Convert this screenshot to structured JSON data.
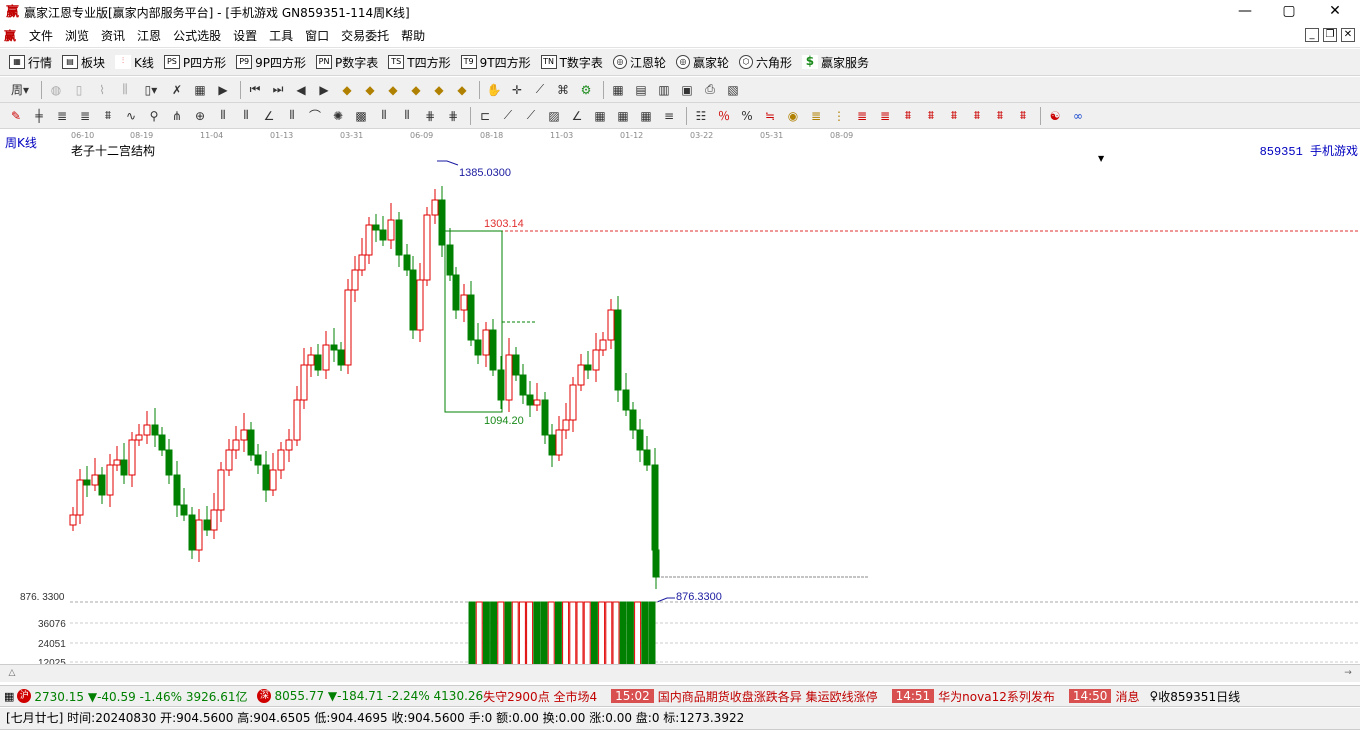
{
  "window": {
    "title": "赢家江恩专业版[赢家内部服务平台] - [手机游戏  GN859351-114周K线]",
    "logo_char": "赢",
    "min": "—",
    "max": "▢",
    "close": "✕"
  },
  "menu": [
    "文件",
    "浏览",
    "资讯",
    "江恩",
    "公式选股",
    "设置",
    "工具",
    "窗口",
    "交易委托",
    "帮助"
  ],
  "toolbar1": [
    {
      "icon": "grid-icon",
      "label": "行情"
    },
    {
      "icon": "block-icon",
      "label": "板块"
    },
    {
      "icon": "kline-icon",
      "label": "K线"
    },
    {
      "icon": "PS",
      "label": "P四方形"
    },
    {
      "icon": "P9",
      "label": "9P四方形"
    },
    {
      "icon": "PN",
      "label": "P数字表"
    },
    {
      "icon": "TS",
      "label": "T四方形"
    },
    {
      "icon": "T9",
      "label": "9T四方形"
    },
    {
      "icon": "TN",
      "label": "T数字表"
    },
    {
      "icon": "wheel-icon",
      "label": "江恩轮"
    },
    {
      "icon": "wheel-icon",
      "label": "赢家轮"
    },
    {
      "icon": "hexagon-icon",
      "label": "六角形"
    },
    {
      "icon": "dollar-icon",
      "label": "赢家服务"
    }
  ],
  "chart": {
    "period_label": "周K线",
    "indicator_name": "老子十二宫结构",
    "code_label": "859351  手机游戏",
    "time_axis": [
      "06-10",
      "08-19",
      "11-04",
      "01-13",
      "03-31",
      "06-09",
      "08-18",
      "11-03",
      "01-12",
      "03-22",
      "05-31",
      "08-09"
    ],
    "high_label": "1385.0300",
    "resistance_label": "1303.14",
    "box_low_label": "1094.20",
    "low_label": "876.3300",
    "left_price_label": "876. 3300",
    "volume_labels": [
      "36076",
      "24051",
      "12025"
    ],
    "colors": {
      "up": "#e00000",
      "down": "#008000",
      "resistance": "#e03030",
      "label": "#1a1aa0",
      "box": "#008000"
    }
  },
  "ticker": {
    "sh_badge": "沪",
    "sh_text": "2730.15 ▼-40.59 -1.46% 3926.61亿",
    "sz_badge": "深",
    "sz_text": "8055.77 ▼-184.71 -2.24% 4130.26",
    "news": [
      {
        "time": "",
        "text": "失守2900点 全市场4"
      },
      {
        "time": "15:02",
        "text": "国内商品期货收盘涨跌各异 集运欧线涨停"
      },
      {
        "time": "14:51",
        "text": "华为nova12系列发布"
      },
      {
        "time": "14:50",
        "text": "消息"
      }
    ],
    "right_text": "收859351日线"
  },
  "status": "[七月廿七] 时间:20240830 开:904.5600 高:904.6505 低:904.4695 收:904.5600 手:0 额:0.00 换:0.00 涨:0.00 盘:0 标:1273.3922"
}
